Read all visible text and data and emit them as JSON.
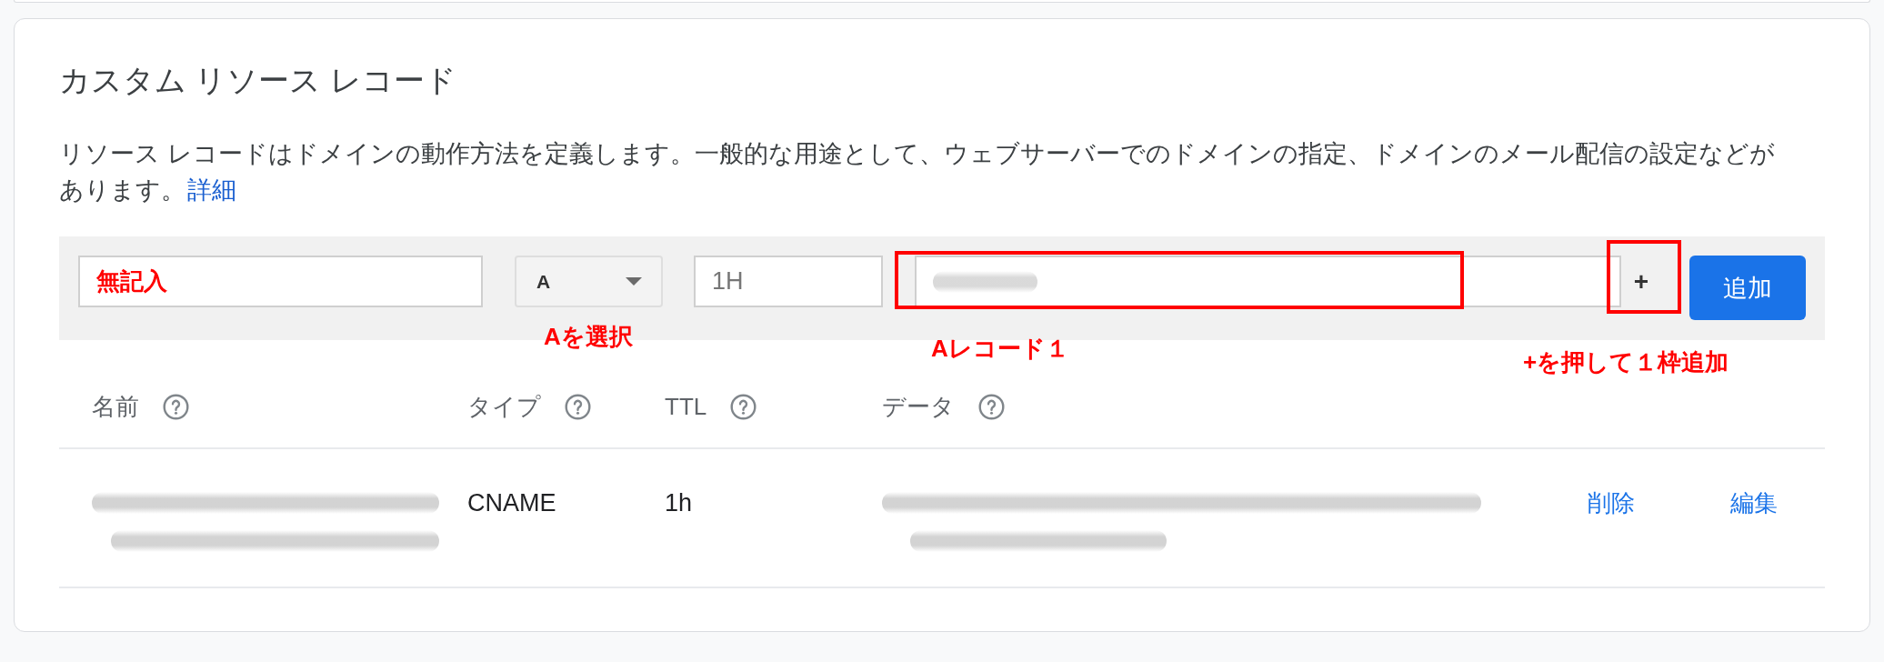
{
  "card": {
    "title": "カスタム リソース レコード",
    "description": "リソース レコードはドメインの動作方法を定義します。一般的な用途として、ウェブサーバーでのドメインの指定、ドメインのメール配信の設定などがあります。",
    "learn_more_link": "詳細"
  },
  "record_form": {
    "name_field": {
      "note": "無記入"
    },
    "type_select": {
      "value": "A",
      "note": "Aを選択"
    },
    "ttl_field": {
      "placeholder": "1H"
    },
    "data_field": {
      "highlighted": true,
      "note": "Aレコード１"
    },
    "add_field_button": {
      "label": "+",
      "highlighted": true,
      "note": "+を押して１枠追加"
    },
    "submit_button": {
      "label": "追加"
    }
  },
  "records_table": {
    "columns": [
      {
        "label": "名前",
        "help": true
      },
      {
        "label": "タイプ",
        "help": true
      },
      {
        "label": "TTL",
        "help": true
      },
      {
        "label": "データ",
        "help": true
      }
    ],
    "rows": [
      {
        "type": "CNAME",
        "ttl": "1h",
        "actions": [
          "削除",
          "編集"
        ]
      }
    ]
  }
}
